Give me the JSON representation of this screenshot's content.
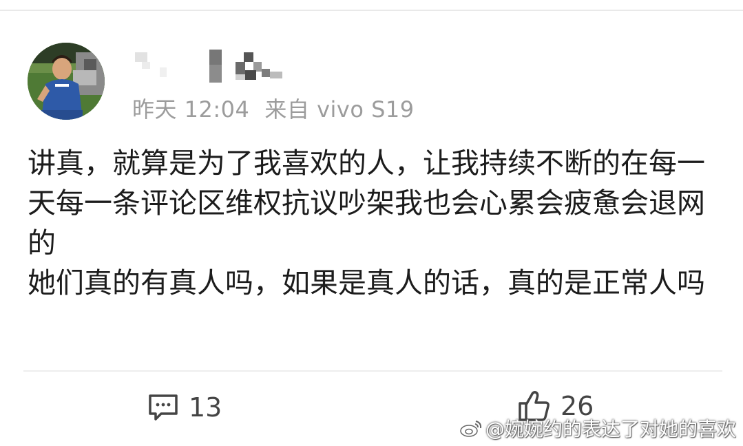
{
  "post": {
    "username_censored": "",
    "meta": {
      "time": "昨天 12:04",
      "source": "来自 vivo S19"
    },
    "content_lines": [
      "讲真，就算是为了我喜欢的人，让我持续不断的在每一天每一条评论区维权抗议吵架我也会心累会疲惫会退网的",
      "她们真的有真人吗，如果是真人的话，真的是正常人吗"
    ]
  },
  "actions": {
    "comment_count": "13",
    "like_count": "26"
  },
  "watermark": {
    "text": "@婉婉约的表达了对她的喜欢"
  },
  "colors": {
    "meta_text": "#9c9c9c",
    "content_text": "#1c1c1c",
    "icon": "#444444"
  }
}
